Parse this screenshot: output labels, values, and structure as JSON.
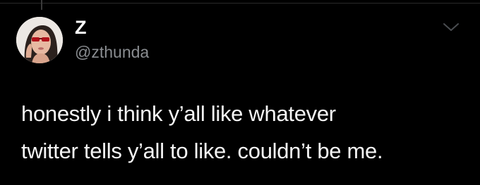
{
  "tweet": {
    "display_name": "Z",
    "handle": "@zthunda",
    "lines": [
      "honestly i think y’all like whatever",
      "twitter tells y’all to like. couldn’t be me."
    ]
  },
  "icons": {
    "avatar": "profile-photo",
    "menu": "chevron-down-icon"
  },
  "colors": {
    "background": "#000000",
    "text": "#ffffff",
    "secondary_text": "#8a8d91"
  }
}
